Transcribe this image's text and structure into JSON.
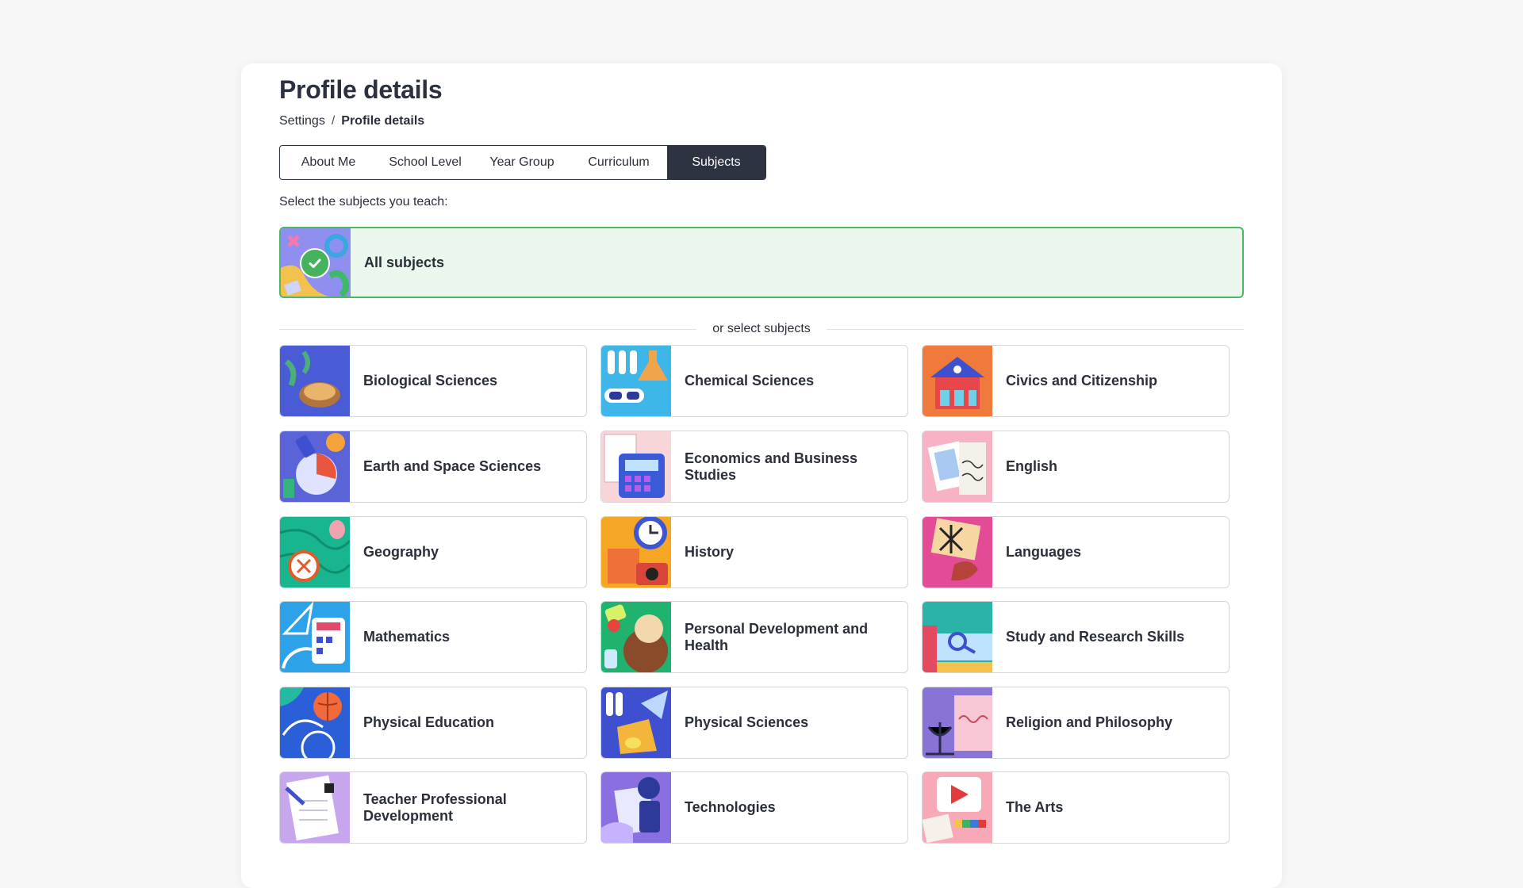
{
  "page": {
    "title": "Profile details",
    "breadcrumb": {
      "parent": "Settings",
      "separator": "/",
      "current": "Profile details"
    }
  },
  "tabs": [
    {
      "label": "About Me",
      "active": false
    },
    {
      "label": "School Level",
      "active": false
    },
    {
      "label": "Year Group",
      "active": false
    },
    {
      "label": "Curriculum",
      "active": false
    },
    {
      "label": "Subjects",
      "active": true
    }
  ],
  "prompt": "Select the subjects you teach:",
  "all_subjects": {
    "label": "All subjects",
    "selected": true,
    "icon": "check-icon"
  },
  "divider_text": "or select subjects",
  "subjects": [
    {
      "label": "Biological Sciences",
      "icon": "turtle-illustration",
      "colors": [
        "#4a5bd6",
        "#4cae7a"
      ]
    },
    {
      "label": "Chemical Sciences",
      "icon": "test-tubes-illustration",
      "colors": [
        "#3fb6e8",
        "#f0a54a"
      ]
    },
    {
      "label": "Civics and Citizenship",
      "icon": "parliament-illustration",
      "colors": [
        "#f07a3c",
        "#3e4fd0"
      ]
    },
    {
      "label": "Earth and Space Sciences",
      "icon": "planet-illustration",
      "colors": [
        "#5a63d8",
        "#f6a23a"
      ]
    },
    {
      "label": "Economics and Business Studies",
      "icon": "calculator-illustration",
      "colors": [
        "#f7d5d9",
        "#3a5bd8"
      ]
    },
    {
      "label": "English",
      "icon": "book-illustration",
      "colors": [
        "#f7b2c4",
        "#a9c9f2"
      ]
    },
    {
      "label": "Geography",
      "icon": "compass-illustration",
      "colors": [
        "#18b58f",
        "#f2a3b0"
      ]
    },
    {
      "label": "History",
      "icon": "clock-illustration",
      "colors": [
        "#f5a623",
        "#3c56d6"
      ]
    },
    {
      "label": "Languages",
      "icon": "speech-illustration",
      "colors": [
        "#e44b97",
        "#f6d7a4"
      ]
    },
    {
      "label": "Mathematics",
      "icon": "protractor-illustration",
      "colors": [
        "#2ea2e8",
        "#3b4fd0"
      ]
    },
    {
      "label": "Personal Development and Health",
      "icon": "wellbeing-illustration",
      "colors": [
        "#20b36f",
        "#8a4b2a"
      ]
    },
    {
      "label": "Study and Research Skills",
      "icon": "magnifier-illustration",
      "colors": [
        "#2bb3a8",
        "#e34a5f"
      ]
    },
    {
      "label": "Physical Education",
      "icon": "ball-illustration",
      "colors": [
        "#2a5fd8",
        "#f26a3b"
      ]
    },
    {
      "label": "Physical Sciences",
      "icon": "prism-illustration",
      "colors": [
        "#3e4fd0",
        "#f4b63a"
      ]
    },
    {
      "label": "Religion and Philosophy",
      "icon": "menorah-illustration",
      "colors": [
        "#8a73d6",
        "#f7c7d3"
      ]
    },
    {
      "label": "Teacher Professional Development",
      "icon": "notepad-illustration",
      "colors": [
        "#c8a6ee",
        "#ffffff"
      ]
    },
    {
      "label": "Technologies",
      "icon": "robot-illustration",
      "colors": [
        "#8a6fe0",
        "#2e3a9a"
      ]
    },
    {
      "label": "The Arts",
      "icon": "palette-illustration",
      "colors": [
        "#f7a9b8",
        "#e33b3b"
      ]
    }
  ]
}
